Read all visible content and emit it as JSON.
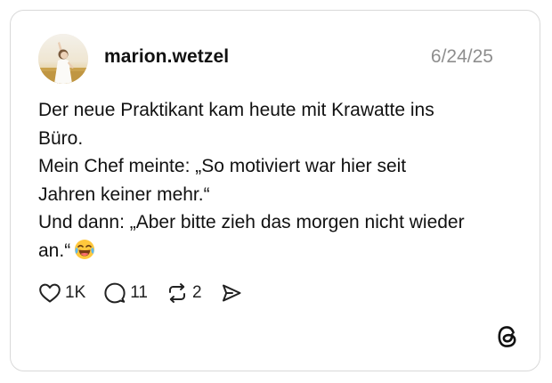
{
  "post": {
    "username": "marion.wetzel",
    "date": "6/24/25",
    "lines": [
      "Der neue Praktikant kam heute mit Krawatte ins",
      "Büro.",
      "Mein Chef meinte: „So motiviert war hier seit",
      "Jahren keiner mehr.“",
      "Und dann: „Aber bitte zieh das morgen nicht wieder",
      "an.“"
    ],
    "trailing_emoji": "face-with-tears-of-joy"
  },
  "actions": {
    "like_count": "1K",
    "reply_count": "11",
    "repost_count": "2"
  },
  "icons": {
    "like": "heart-icon",
    "reply": "speech-bubble-icon",
    "repost": "repost-icon",
    "share": "send-icon",
    "brand": "threads-logo"
  }
}
